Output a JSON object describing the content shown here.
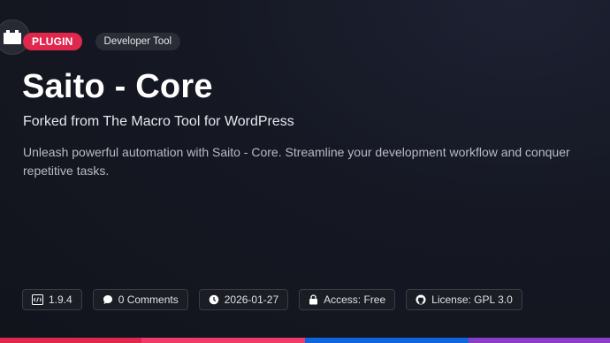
{
  "header": {
    "type_badge": "PLUGIN",
    "category_badge": "Developer Tool",
    "icon": "plugin-box-icon"
  },
  "main": {
    "title": "Saito - Core",
    "subtitle": "Forked from The Macro Tool for WordPress",
    "description": "Unleash powerful automation with Saito - Core. Streamline your development workflow and conquer repetitive tasks."
  },
  "meta": {
    "version": "1.9.4",
    "comments": "0 Comments",
    "date": "2026-01-27",
    "access": "Access: Free",
    "license": "License: GPL 3.0"
  },
  "colors": {
    "accent": "#e0284f",
    "bar_segments": [
      "#e0284f",
      "#f03a6a",
      "#1166e0",
      "#8b3fc9"
    ]
  }
}
